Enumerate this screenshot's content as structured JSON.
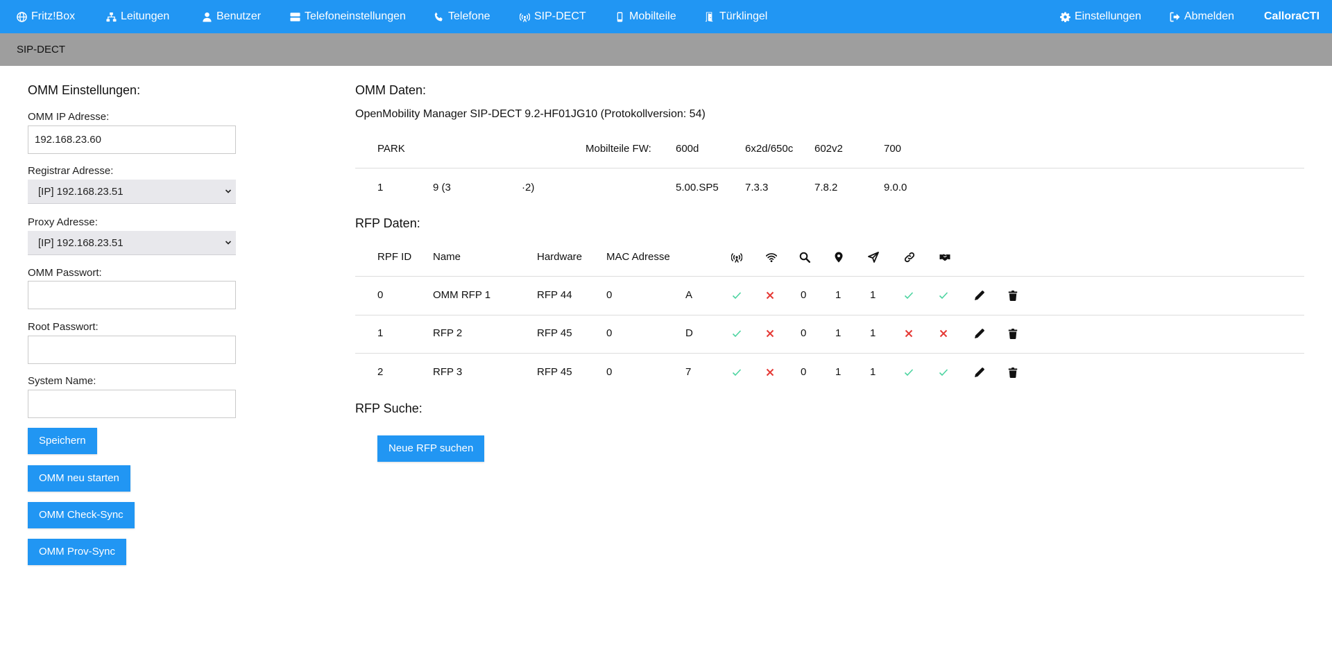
{
  "nav": {
    "items": [
      {
        "label": "Fritz!Box",
        "icon": "globe-icon"
      },
      {
        "label": "Leitungen",
        "icon": "network-icon"
      },
      {
        "label": "Benutzer",
        "icon": "user-icon"
      },
      {
        "label": "Telefoneinstellungen",
        "icon": "server-icon"
      },
      {
        "label": "Telefone",
        "icon": "phone-icon"
      },
      {
        "label": "SIP-DECT",
        "icon": "antenna-icon"
      },
      {
        "label": "Mobilteile",
        "icon": "mobile-icon"
      },
      {
        "label": "Türklingel",
        "icon": "door-icon"
      }
    ],
    "right": [
      {
        "label": "Einstellungen",
        "icon": "gear-icon"
      },
      {
        "label": "Abmelden",
        "icon": "logout-icon"
      }
    ],
    "brand": "CalloraCTI"
  },
  "subheader": {
    "title": "SIP-DECT"
  },
  "omm_settings": {
    "heading": "OMM Einstellungen:",
    "ip_label": "OMM IP Adresse:",
    "ip_value": "192.168.23.60",
    "registrar_label": "Registrar Adresse:",
    "registrar_value": "[IP] 192.168.23.51",
    "proxy_label": "Proxy Adresse:",
    "proxy_value": "[IP] 192.168.23.51",
    "omm_password_label": "OMM Passwort:",
    "omm_password_value": "",
    "root_password_label": "Root Passwort:",
    "root_password_value": "",
    "system_name_label": "System Name:",
    "system_name_value": "",
    "buttons": {
      "save": "Speichern",
      "restart": "OMM neu starten",
      "check_sync": "OMM Check-Sync",
      "prov_sync": "OMM Prov-Sync"
    }
  },
  "omm_data": {
    "heading": "OMM Daten:",
    "info": "OpenMobility Manager SIP-DECT 9.2-HF01JG10 (Protokollversion: 54)",
    "headers": {
      "park": "PARK",
      "mobile_fw": "Mobilteile FW:",
      "fw_600d": "600d",
      "fw_6x2d": "6x2d/650c",
      "fw_602v2": "602v2",
      "fw_700": "700"
    },
    "row": {
      "park": "1",
      "park_part1": "9 (3",
      "park_part2": "·2)",
      "v600d": "5.00.SP5",
      "v6x2d": "7.3.3",
      "v602v2": "7.8.2",
      "v700": "9.0.0"
    }
  },
  "rfp_data": {
    "heading": "RFP Daten:",
    "columns": {
      "id": "RPF ID",
      "name": "Name",
      "hardware": "Hardware",
      "mac": "MAC Adresse"
    },
    "status_icons": [
      "antenna-icon",
      "wifi-icon",
      "search-icon",
      "location-pin-icon",
      "send-icon",
      "link-icon",
      "handshake-icon"
    ],
    "rows": [
      {
        "id": "0",
        "name": "OMM RFP 1",
        "hardware": "RFP 44",
        "mac": "0",
        "site": "A",
        "c1": "check",
        "c2": "cross",
        "v3": "0",
        "v4": "1",
        "v5": "1",
        "c6": "check",
        "c7": "check"
      },
      {
        "id": "1",
        "name": "RFP 2",
        "hardware": "RFP 45",
        "mac": "0",
        "site": "D",
        "c1": "check",
        "c2": "cross",
        "v3": "0",
        "v4": "1",
        "v5": "1",
        "c6": "cross",
        "c7": "cross"
      },
      {
        "id": "2",
        "name": "RFP 3",
        "hardware": "RFP 45",
        "mac": "0",
        "site": "7",
        "c1": "check",
        "c2": "cross",
        "v3": "0",
        "v4": "1",
        "v5": "1",
        "c6": "check",
        "c7": "check"
      }
    ]
  },
  "rfp_search": {
    "heading": "RFP Suche:",
    "button": "Neue RFP suchen"
  },
  "colors": {
    "primary": "#2196f3",
    "check": "#4cd4a0",
    "cross": "#e53935"
  }
}
